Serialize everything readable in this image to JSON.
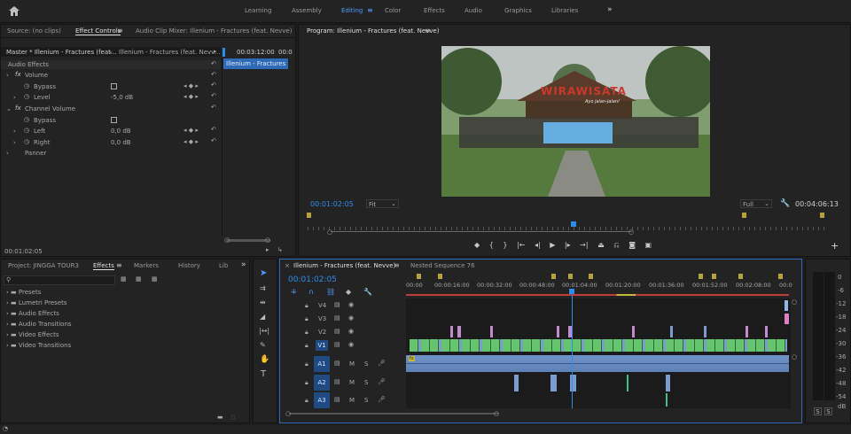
{
  "workspace": {
    "tabs": [
      "Learning",
      "Assembly",
      "Editing",
      "Color",
      "Effects",
      "Audio",
      "Graphics",
      "Libraries"
    ],
    "active": "Editing",
    "more": "»"
  },
  "source_panel": {
    "tabs": [
      "Source: (no clips)",
      "Effect Controls",
      "Audio Clip Mixer: Illenium - Fractures (feat. Nevve)"
    ],
    "master": "Master * Illenium - Fractures (feat...",
    "clip": "Illenium - Fractures (feat. Nevv...",
    "tc1": "00:03:12:00",
    "tc2": "00:0",
    "clip_bar": "Illenium - Fractures (fe",
    "section": "Audio Effects",
    "rows": [
      {
        "fx": "fx",
        "label": "Volume",
        "value": ""
      },
      {
        "fx": "",
        "label": "Bypass",
        "value": ""
      },
      {
        "fx": "",
        "label": "Level",
        "value": "-5,0 dB"
      },
      {
        "fx": "fx",
        "label": "Channel Volume",
        "value": ""
      },
      {
        "fx": "",
        "label": "Bypass",
        "value": ""
      },
      {
        "fx": "",
        "label": "Left",
        "value": "0,0 dB"
      },
      {
        "fx": "",
        "label": "Right",
        "value": "0,0 dB"
      },
      {
        "fx": "",
        "label": "Panner",
        "value": ""
      }
    ],
    "timecode": "00:01:02:05"
  },
  "program": {
    "title": "Program: Illenium - Fractures (feat. Nevve)",
    "timecode": "00:01:02:05",
    "fit": "Fit",
    "quality": "Full",
    "duration": "00:04:06:13",
    "banner": "WIRAWISATA",
    "banner_sub": "Ayo jalan-jalan!"
  },
  "project": {
    "tabs": [
      "Project: JINGGA TOUR3",
      "Effects",
      "Markers",
      "History",
      "Lib"
    ],
    "active": "Effects",
    "folders": [
      "Presets",
      "Lumetri Presets",
      "Audio Effects",
      "Audio Transitions",
      "Video Effects",
      "Video Transitions"
    ],
    "search_placeholder": ""
  },
  "timeline": {
    "tabs": [
      "Illenium - Fractures (feat. Nevve)",
      "Nested Sequence 76"
    ],
    "timecode": "00:01:02:05",
    "ruler": [
      "00:00",
      "00:00:16:00",
      "00:00:32:00",
      "00:00:48:00",
      "00:01:04:00",
      "00:01:20:00",
      "00:01:36:00",
      "00:01:52:00",
      "00:02:08:00",
      "00:0"
    ],
    "vtracks": [
      "V4",
      "V3",
      "V2",
      "V1"
    ],
    "atracks": [
      "A1",
      "A2",
      "A3"
    ],
    "m": "M",
    "s": "S",
    "fx_badge": "fx"
  },
  "meter": {
    "scale": [
      "0",
      "-6",
      "-12",
      "-18",
      "-24",
      "-30",
      "-36",
      "-42",
      "-48",
      "-54",
      "dB"
    ],
    "solo": [
      "S",
      "S"
    ]
  },
  "colors": {
    "accent": "#2d8ceb",
    "video_clip": "#64c56e",
    "audio_clip": "#7a9ccf",
    "pink_clip": "#c28bd0",
    "marker": "#b8a23a"
  }
}
